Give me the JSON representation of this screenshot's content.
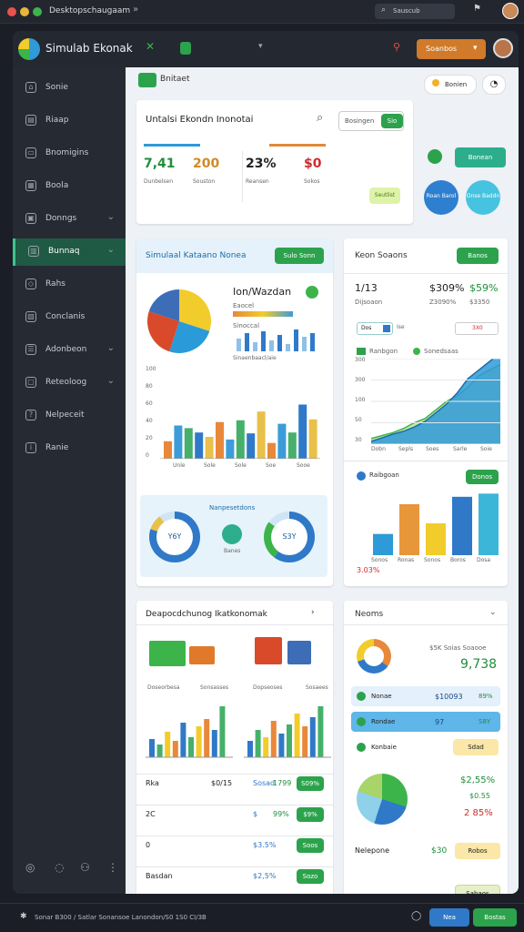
{
  "titlebar": {
    "title": "Desktopschaugaam"
  },
  "app": {
    "title": "Simulab Ekonak",
    "search_label": "Sauscub",
    "header_button": "Soanbos"
  },
  "sidebar": {
    "items": [
      {
        "label": "Sonie",
        "icon": "home-icon",
        "chevron": false,
        "active": false
      },
      {
        "label": "Riaap",
        "icon": "doc-icon",
        "chevron": false,
        "active": false
      },
      {
        "label": "Bnomigins",
        "icon": "folder-icon",
        "chevron": false,
        "active": false
      },
      {
        "label": "Boola",
        "icon": "grid-icon",
        "chevron": false,
        "active": false
      },
      {
        "label": "Donngs",
        "icon": "calendar-icon",
        "chevron": true,
        "active": false
      },
      {
        "label": "Bunnaq",
        "icon": "chart-icon",
        "chevron": true,
        "active": true
      },
      {
        "label": "Rahs",
        "icon": "tag-icon",
        "chevron": false,
        "active": false
      },
      {
        "label": "Conclanis",
        "icon": "building-icon",
        "chevron": false,
        "active": false
      },
      {
        "label": "Adonbeon",
        "icon": "list-icon",
        "chevron": true,
        "active": false
      },
      {
        "label": "Reteoloog",
        "icon": "note-icon",
        "chevron": true,
        "active": false
      },
      {
        "label": "Nelpeceit",
        "icon": "help-icon",
        "chevron": false,
        "active": false
      },
      {
        "label": "Ranie",
        "icon": "info-icon",
        "chevron": false,
        "active": false
      }
    ]
  },
  "toolbar": {
    "breadcrumb": "Bnitaet",
    "pill": "Bonien"
  },
  "top_card": {
    "title": "Untalsi Ekondn Inonotai",
    "filter_label": "Bosingen",
    "go_label": "Sio",
    "stats": [
      {
        "value": "7,41",
        "label": "Dunbelsen",
        "color": "#1f8f3a"
      },
      {
        "value": "200",
        "label": "Souston",
        "color": "#d28a20"
      },
      {
        "value": "23%",
        "label": "Reansen",
        "color": "#222222"
      },
      {
        "value": "$0",
        "label": "Sokos",
        "color": "#d02a2a"
      }
    ],
    "badge": "Seutlist"
  },
  "side_top": {
    "btn": "Bonean",
    "circle1": "Roan Barol",
    "circle2": "Onse Baddn"
  },
  "main_card": {
    "title": "Simulaal Kataano Nonea",
    "btn": "Sulo Sonn",
    "header": "Ion/Wazdan",
    "sub1": "Eaocel",
    "sub2": "Sinoccal",
    "sub3": "Sinaenbaacl/aie",
    "yticks": [
      "100",
      "80",
      "60",
      "40",
      "20",
      "0"
    ],
    "xticks": [
      "Unle",
      "Sole",
      "Sole",
      "Soe",
      "Sooe"
    ],
    "ring_title": "Nanpesetdons",
    "ring1": "Y6Y",
    "ring2": "S3Y",
    "ring_sub": "Banes"
  },
  "right_card": {
    "title": "Keon Soaons",
    "btn": "Banos",
    "v1": "1/13",
    "v1_sub": "Dijsoaon",
    "v2": "$309%",
    "v2_sub": "Z3090%",
    "v3": "$59%",
    "v3_sub": "$3350",
    "chip1": "Dos",
    "chip2": "Ise",
    "chip3": "3X0",
    "legend1": "Ranbgon",
    "legend2": "Sonedsaas",
    "yticks": [
      "300",
      "300",
      "100",
      "50",
      "30"
    ],
    "xticks": [
      "Dobn",
      "Sepls",
      "Soes",
      "Sarle",
      "Soie"
    ],
    "sub_title": "Raibgoan",
    "sub_btn": "Donos",
    "bar_val": "3.03%",
    "bar_x": [
      "Sonos",
      "Ronas",
      "Sonos",
      "Boros",
      "Dosa"
    ]
  },
  "bottom_left": {
    "title": "Deapocdchunog Ikatkonomak",
    "labels": [
      "Doseorbesa",
      "Sonsasses",
      "Dopseoses",
      "Sosaees"
    ],
    "rows": [
      {
        "c1": "Rka",
        "c2": "$0/15",
        "c3": "Sosad",
        "c4": "1799",
        "btn": "S09%"
      },
      {
        "c1": "2C",
        "c2": "",
        "c3": "$",
        "c4": "99%",
        "btn": "$9%"
      },
      {
        "c1": "0",
        "c2": "",
        "c3": "$3.5%",
        "c4": "",
        "btn": "Soos"
      },
      {
        "c1": "Basdan",
        "c2": "",
        "c3": "$2,5%",
        "c4": "",
        "btn": "Sozo"
      }
    ]
  },
  "bottom_right": {
    "title": "Neoms",
    "stat1": "$5K Soias Soaooe",
    "stat2": "9,738",
    "rows": [
      {
        "label": "Nonae",
        "value": "$10093",
        "pct": "89%"
      },
      {
        "label": "Rondae",
        "value": "97",
        "pct": "S8Y"
      },
      {
        "label": "Konbaie",
        "value": "Sdad"
      }
    ],
    "v1": "$2,55%",
    "v2": "$0.55",
    "v3": "2 85%",
    "footer_label": "Nelepone",
    "footer_val": "$30",
    "footer_btn": "Robos",
    "bottom_btn": "Sabaos"
  },
  "status": {
    "text": "Sonar B300 / Satlar Sonansoe Lanondon/S0 1S0 CI/3B",
    "btn1": "Nea",
    "btn2": "Bostas"
  },
  "colors": {
    "accent": "#2ca24c",
    "sidebar": "#252a33",
    "active": "#1f5a44",
    "blue": "#2f8fd8",
    "orange": "#e0893a",
    "teal": "#3cb6c4"
  },
  "chart_data": [
    {
      "type": "pie",
      "title": "Ion/Wazdan",
      "values": [
        30,
        25,
        25,
        20
      ],
      "colors": [
        "#f2cc2a",
        "#2a9bd8",
        "#d84a2a",
        "#3c6db6"
      ]
    },
    {
      "type": "bar",
      "title": "",
      "categories": [
        "Unle",
        "Sole",
        "Sole",
        "Soe",
        "Sooe"
      ],
      "series": [
        {
          "name": "",
          "values": [
            20,
            38,
            35,
            30,
            25,
            42,
            22,
            44,
            29,
            54,
            18,
            40,
            30,
            62,
            45
          ]
        }
      ],
      "ylim": [
        0,
        100
      ],
      "colors": [
        "#e8883a",
        "#3c9cd8",
        "#46b06a",
        "#2f79c8",
        "#e8c04a"
      ]
    },
    {
      "type": "area",
      "title": "",
      "x": [
        "Dobn",
        "Sepls",
        "Soes",
        "Sarle",
        "Soie"
      ],
      "series": [
        {
          "name": "Ranbgon",
          "values": [
            10,
            22,
            35,
            45,
            60,
            80,
            110,
            140,
            180,
            230,
            260,
            290,
            320
          ]
        },
        {
          "name": "Sonedsaas",
          "values": [
            20,
            30,
            40,
            55,
            75,
            90,
            120,
            150,
            170,
            200,
            240,
            260,
            280
          ]
        }
      ],
      "ylim": [
        0,
        300
      ]
    },
    {
      "type": "bar",
      "title": "",
      "categories": [
        "Sonos",
        "Ronas",
        "Sonos",
        "Boros",
        "Dosa"
      ],
      "values": [
        20,
        48,
        30,
        55,
        58
      ],
      "colors": [
        "#2f9ad8",
        "#e8963a",
        "#f2cc2a",
        "#2f79c8",
        "#3cb6d8"
      ]
    }
  ]
}
